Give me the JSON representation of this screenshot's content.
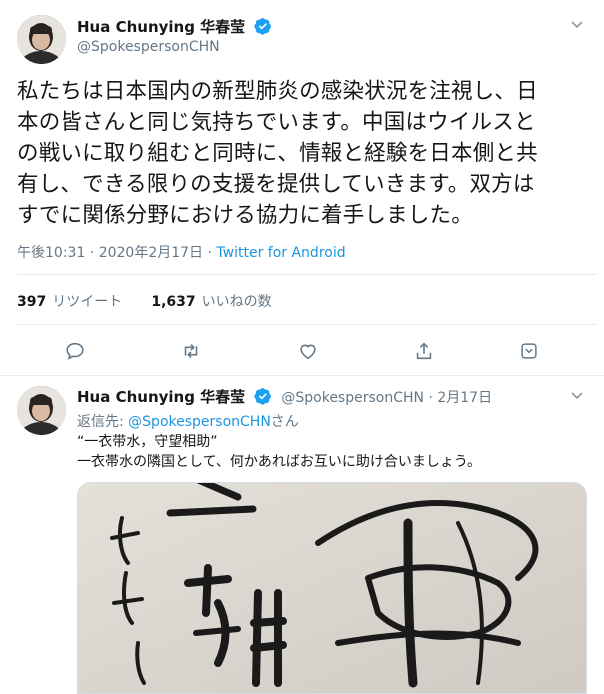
{
  "main_tweet": {
    "author_name": "Hua Chunying 华春莹",
    "handle": "@SpokespersonCHN",
    "text_lines": [
      "私たちは日本国内の新型肺炎の感染状況を注視し、日",
      "本の皆さんと同じ気持ちでいます。中国はウイルスと",
      "の戦いに取り組むと同時に、情報と経験を日本側と共",
      "有し、できる限りの支援を提供していきます。双方は",
      "すでに関係分野における協力に着手しました。"
    ],
    "timestamp": "午後10:31 · 2020年2月17日 · ",
    "source": "Twitter for Android",
    "retweets_count": "397",
    "retweets_label": "リツイート",
    "likes_count": "1,637",
    "likes_label": "いいねの数"
  },
  "reply_tweet": {
    "author_name": "Hua Chunying 华春莹",
    "handle_date": "@SpokespersonCHN · 2月17日",
    "reply_prefix": "返信先: ",
    "reply_handle": "@SpokespersonCHN",
    "reply_suffix": "さん",
    "line1": "“一衣带水，守望相助”",
    "line2": "一衣帯水の隣国として、何かあればお互いに助け合いましょう。"
  },
  "icons": {
    "menu": "chevron-down-icon",
    "verified": "verified-badge-icon",
    "reply": "reply-icon",
    "retweet": "retweet-icon",
    "like": "heart-icon",
    "share": "share-icon",
    "save": "save-icon"
  },
  "colors": {
    "accent": "#1da1f2",
    "secondary_text": "#657786",
    "divider": "#e6ecf0"
  }
}
